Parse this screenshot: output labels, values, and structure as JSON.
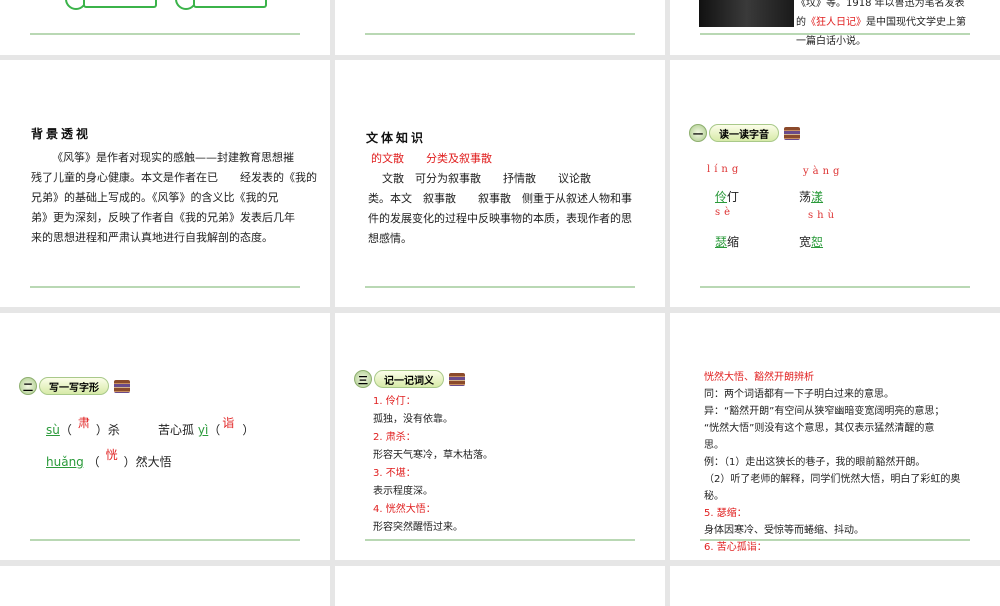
{
  "slides": {
    "top_right": {
      "lines": [
        "《坟》等。1918 年以鲁迅为笔名发表",
        "的",
        "《狂人日记》",
        "是中国现代文学史上第",
        "一篇白话小说。"
      ]
    },
    "background": {
      "title": "背景透视",
      "lines": [
        "《风筝》是作者对现实的感触——封建教育思想摧",
        "残了儿童的身心健康。本文是作者在已　　经发表的《我的",
        "兄弟》的基础上写成的。《风筝》的含义比《我的兄",
        "弟》更为深刻，反映了作者自《我的兄弟》发表后几年",
        "来的思想进程和严肃认真地进行自我解剖的态度。"
      ]
    },
    "genre": {
      "title": "文体知识",
      "red_a": "的文散",
      "red_b": "分类及叙事散",
      "lines": [
        "文散　可分为叙事散　　抒情散　　议论散",
        "类。本文　叙事散　　叙事散　侧重于从叙述人物和事",
        "件的发展变化的过程中反映事物的本质，表现作者的思",
        "想感情。"
      ]
    },
    "read": {
      "num": "一",
      "label": "读一读字音",
      "items": [
        {
          "py": "líng",
          "a": "伶",
          "b": "仃",
          "hl": "a"
        },
        {
          "py": "yàng",
          "a": "荡",
          "b": "漾",
          "hl": "b"
        },
        {
          "py": "sè",
          "a": "瑟",
          "b": "缩",
          "hl": "a"
        },
        {
          "py": "shù",
          "a": "宽",
          "b": "恕",
          "hl": "b"
        }
      ]
    },
    "write": {
      "num": "二",
      "label": "写一写字形",
      "row1": {
        "py1": "sù",
        "ans1": "肃",
        "tail1": "）杀",
        "pre2": "苦心孤",
        "py2": "yì",
        "ans2": "诣",
        "tail2": "）"
      },
      "row2": {
        "py": "huǎng",
        "ans": "恍",
        "tail": "）然大悟"
      },
      "open": "（"
    },
    "meaning": {
      "num": "三",
      "label": "记一记词义",
      "items": [
        {
          "term": "1. 伶仃：",
          "def": "孤独，没有依靠。"
        },
        {
          "term": "2. 肃杀：",
          "def": "形容天气寒冷，草木枯落。"
        },
        {
          "term": "3. 不堪：",
          "def": "表示程度深。"
        },
        {
          "term": "4. 恍然大悟：",
          "def": "形容突然醒悟过来。"
        }
      ]
    },
    "analysis": {
      "title": "恍然大悟、豁然开朗辨析",
      "lines": [
        "同：两个词语都有一下子明白过来的意思。",
        "异：“豁然开朗”有空间从狭窄幽暗变宽阔明亮的意思；",
        "“恍然大悟”则没有这个意思，其仅表示猛然清醒的意",
        "思。",
        "例：（1）走出这狭长的巷子，我的眼前豁然开朗。",
        "（2）听了老师的解释，同学们恍然大悟，明白了彩虹的奥",
        "秘。"
      ],
      "t5": "5. 瑟缩：",
      "d5": "身体因寒冷、受惊等而蜷缩、抖动。",
      "t6": "6. 苦心孤诣："
    }
  }
}
